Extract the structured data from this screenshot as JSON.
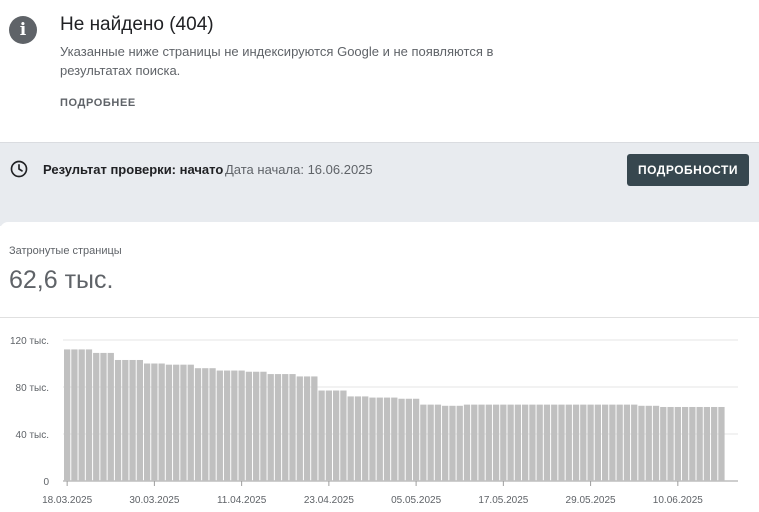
{
  "header": {
    "title": "Не найдено (404)",
    "description": "Указанные ниже страницы не индексируются Google и не появляются в результатах поиска.",
    "more_link": "ПОДРОБНЕЕ",
    "icon": "info-icon"
  },
  "status": {
    "label": "Результат проверки: начато",
    "date": "Дата начала: 16.06.2025",
    "button": "ПОДРОБНОСТИ",
    "icon": "clock-icon"
  },
  "metric": {
    "label": "Затронутые страницы",
    "value": "62,6 тыс."
  },
  "colors": {
    "bar": "#c0c0c0",
    "button_bg": "#37474f",
    "status_bg": "#e8ebef",
    "grid": "#e6e6e6"
  },
  "chart_data": {
    "type": "bar",
    "y_ticks": [
      {
        "value": 0,
        "label": "0"
      },
      {
        "value": 40,
        "label": "40 тыс."
      },
      {
        "value": 80,
        "label": "80 тыс."
      },
      {
        "value": 120,
        "label": "120 тыс."
      }
    ],
    "x_tick_labels": [
      {
        "index": 0,
        "label": "18.03.2025"
      },
      {
        "index": 12,
        "label": "30.03.2025"
      },
      {
        "index": 24,
        "label": "11.04.2025"
      },
      {
        "index": 36,
        "label": "23.04.2025"
      },
      {
        "index": 48,
        "label": "05.05.2025"
      },
      {
        "index": 60,
        "label": "17.05.2025"
      },
      {
        "index": 72,
        "label": "29.05.2025"
      },
      {
        "index": 84,
        "label": "10.06.2025"
      }
    ],
    "ylim": [
      0,
      120
    ],
    "grid": true,
    "values": [
      112,
      112,
      112,
      112,
      109,
      109,
      109,
      103,
      103,
      103,
      103,
      100,
      100,
      100,
      99,
      99,
      99,
      99,
      96,
      96,
      96,
      94,
      94,
      94,
      94,
      93,
      93,
      93,
      91,
      91,
      91,
      91,
      89,
      89,
      89,
      77,
      77,
      77,
      77,
      72,
      72,
      72,
      71,
      71,
      71,
      71,
      70,
      70,
      70,
      65,
      65,
      65,
      64,
      64,
      64,
      65,
      65,
      65,
      65,
      65,
      65,
      65,
      65,
      65,
      65,
      65,
      65,
      65,
      65,
      65,
      65,
      65,
      65,
      65,
      65,
      65,
      65,
      65,
      65,
      64,
      64,
      64,
      63,
      63,
      63,
      63,
      63,
      63,
      63,
      63,
      63
    ]
  }
}
